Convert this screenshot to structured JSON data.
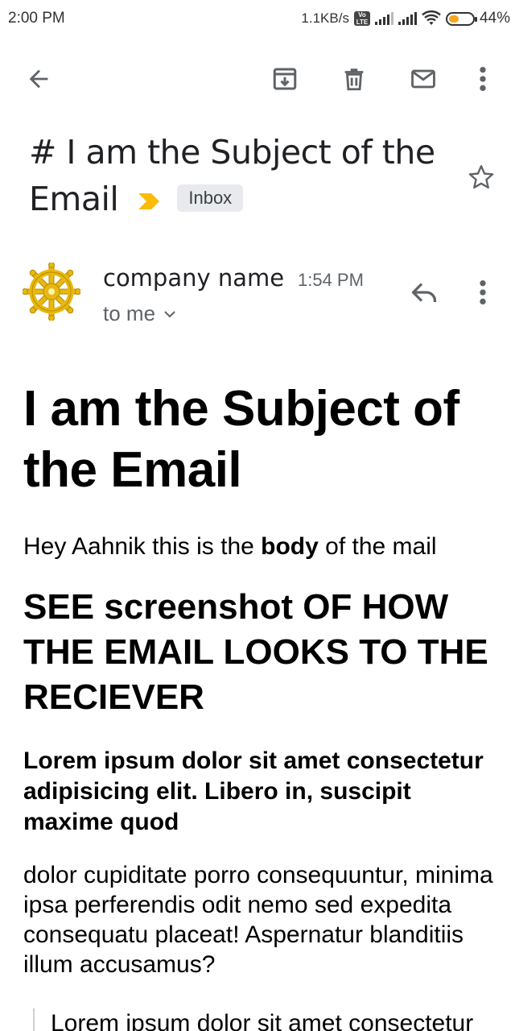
{
  "status_bar": {
    "time": "2:00 PM",
    "net_speed": "1.1KB/s",
    "volte": "Vo LTE",
    "battery": "44%",
    "battery_level": 0.44
  },
  "toolbar": {
    "back": "back-arrow-icon",
    "archive": "archive-icon",
    "delete": "trash-icon",
    "mark_unread": "mail-icon",
    "more": "more-vert-icon"
  },
  "email": {
    "subject": "# I am the Subject of the Email",
    "label": "Inbox",
    "sender_name": "company name",
    "time": "1:54 PM",
    "recipient": "to me",
    "accent_color": "#fbbc04"
  },
  "body": {
    "heading": "I am the Subject of the Email",
    "intro_before": "Hey Aahnik this is the ",
    "intro_bold": "body",
    "intro_after": " of the mail",
    "subheading": "SEE screenshot OF HOW THE EMAIL LOOKS TO THE RECIEVER",
    "bold_paragraph": "Lorem ipsum dolor sit amet consectetur adipisicing elit. Libero in, suscipit maxime quod",
    "paragraph": "dolor cupiditate porro consequuntur, minima ipsa perferendis odit nemo sed expedita consequatu placeat! Aspernatur blanditiis illum accusamus?",
    "quote": "Lorem ipsum dolor sit amet consectetur adipisicing elit. Libero in"
  }
}
